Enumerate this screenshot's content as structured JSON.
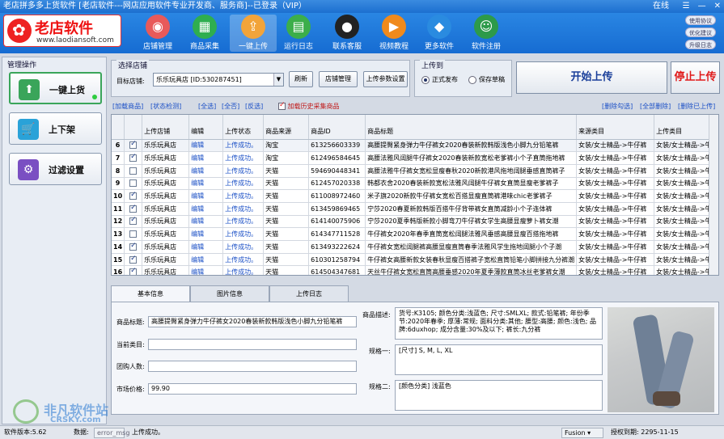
{
  "window": {
    "title": "老店拼多多上货软件 [老店软件---网店应用软件专业开发商、服务商]--已登录（VIP）",
    "online": "在线",
    "controls": [
      "☰",
      "—",
      "✕"
    ]
  },
  "banner": {
    "brand": "老店软件",
    "url": "www.laodiansoft.com",
    "toolbar": [
      {
        "label": "店铺管理",
        "icon": "store-icon",
        "color": "#e85a5a"
      },
      {
        "label": "商品采集",
        "icon": "basket-icon",
        "color": "#2fae4f"
      },
      {
        "label": "一键上传",
        "icon": "upload-icon",
        "color": "#f2a43a"
      },
      {
        "label": "运行日志",
        "icon": "calendar-icon",
        "color": "#3cae4a"
      },
      {
        "label": "联系客服",
        "icon": "qq-penguin-icon",
        "color": "#222222"
      },
      {
        "label": "视频教程",
        "icon": "play-icon",
        "color": "#f08a1c"
      },
      {
        "label": "更多软件",
        "icon": "dropbox-icon",
        "color": "#2a8be0"
      },
      {
        "label": "软件注册",
        "icon": "user-icon",
        "color": "#2d9a4a"
      }
    ],
    "side_buttons": [
      "使用协议",
      "优化建议",
      "升级日志"
    ]
  },
  "left": {
    "title": "管理操作",
    "buttons": [
      {
        "label": "一键上货",
        "icon": "upload-arrow-icon",
        "color": "#3aa55a"
      },
      {
        "label": "上下架",
        "icon": "cart-icon",
        "color": "#2aa2d8"
      },
      {
        "label": "过滤设置",
        "icon": "gear-icon",
        "color": "#7a4fc2"
      }
    ]
  },
  "store": {
    "group_title": "选择店铺",
    "label": "目标店铺:",
    "selected": "乐乐玩具店 [ID:530287451]",
    "refresh": "刷新",
    "manage": "店铺管理",
    "params": "上传参数设置"
  },
  "upload_to": {
    "group_title": "上传到",
    "options": [
      "正式发布",
      "保存草稿"
    ],
    "selected_index": 0
  },
  "actions": {
    "start": "开始上传",
    "stop": "停止上传"
  },
  "links": {
    "left": [
      "[加载商品]",
      "[状态检测]"
    ],
    "select": [
      "[全选]",
      "[全否]",
      "[反选]"
    ],
    "history_label": "加载历史采集商品",
    "history_checked": true,
    "right": [
      "[删除勾选]",
      "[全部删除]",
      "[删除已上传]"
    ]
  },
  "table": {
    "columns": [
      "",
      "",
      "上传店铺",
      "编辑",
      "上传状态",
      "商品来源",
      "商品ID",
      "商品标题",
      "来源类目",
      "上传类目"
    ],
    "rows": [
      {
        "n": "6",
        "checked": true,
        "store": "乐乐玩具店",
        "edit": "编辑",
        "status": "上传成功。",
        "source": "淘宝",
        "id": "613256603339",
        "title": "高腰提臀紧身弹力牛仔裤女2020春装新款韩版浅色小脚九分铅笔裤",
        "src_cat": "女装/女士精品->牛仔裤",
        "up_cat": "女装/女士精品->牛"
      },
      {
        "n": "7",
        "checked": true,
        "store": "乐乐玩具店",
        "edit": "编辑",
        "status": "上传成功。",
        "source": "淘宝",
        "id": "612496584645",
        "title": "高腰法雅风阔腿牛仔裤女2020春装新款宽松老爹裤小个子直筒拖地裤",
        "src_cat": "女装/女士精品->牛仔裤",
        "up_cat": "女装/女士精品->牛"
      },
      {
        "n": "8",
        "checked": false,
        "store": "乐乐玩具店",
        "edit": "编辑",
        "status": "上传成功。",
        "source": "天猫",
        "id": "594690448341",
        "title": "高腰法雅牛仔裤女宽松显瘦春秋2020新款港风拖地阔腿垂感直筒裤子",
        "src_cat": "女装/女士精品->牛仔裤",
        "up_cat": "女装/女士精品->牛"
      },
      {
        "n": "9",
        "checked": false,
        "store": "乐乐玩具店",
        "edit": "编辑",
        "status": "上传成功。",
        "source": "天猫",
        "id": "612457020338",
        "title": "韩都衣舍2020春装新款宽松法雅风阔腿牛仔裤女直筒显瘦老爹裤子",
        "src_cat": "女装/女士精品->牛仔裤",
        "up_cat": "女装/女士精品->牛"
      },
      {
        "n": "10",
        "checked": true,
        "store": "乐乐玩具店",
        "edit": "编辑",
        "status": "上传成功。",
        "source": "天猫",
        "id": "611008972460",
        "title": "米子旗2020新款牛仔裤女宽松百搭显瘦直筒裤港味chic老爹裤子",
        "src_cat": "女装/女士精品->牛仔裤",
        "up_cat": "女装/女士精品->牛"
      },
      {
        "n": "11",
        "checked": true,
        "store": "乐乐玩具店",
        "edit": "编辑",
        "status": "上传成功。",
        "source": "天猫",
        "id": "613459869465",
        "title": "宁莎2020春夏新款韩版百搭牛仔背带裤女直筒减龄小个子连体裤",
        "src_cat": "女装/女士精品->牛仔裤",
        "up_cat": "女装/女士精品->牛"
      },
      {
        "n": "12",
        "checked": true,
        "store": "乐乐玩具店",
        "edit": "编辑",
        "status": "上传成功。",
        "source": "天猫",
        "id": "614140075906",
        "title": "宁莎2020夏季韩版新款小脚弯刀牛仔裤女学生高腰显瘦萝卜裤女潮",
        "src_cat": "女装/女士精品->牛仔裤",
        "up_cat": "女装/女士精品->牛"
      },
      {
        "n": "13",
        "checked": false,
        "store": "乐乐玩具店",
        "edit": "编辑",
        "status": "上传成功。",
        "source": "天猫",
        "id": "614347711528",
        "title": "牛仔裤女2020年春季直筒宽松阔腿法雅风垂感高腰显瘦百搭拖地裤",
        "src_cat": "女装/女士精品->牛仔裤",
        "up_cat": "女装/女士精品->牛"
      },
      {
        "n": "14",
        "checked": true,
        "store": "乐乐玩具店",
        "edit": "编辑",
        "status": "上传成功。",
        "source": "天猫",
        "id": "613493222624",
        "title": "牛仔裤女宽松阔腿裤高腰显瘦直筒春季法雅风学生拖地阔腿小个子潮",
        "src_cat": "女装/女士精品->牛仔裤",
        "up_cat": "女装/女士精品->牛"
      },
      {
        "n": "15",
        "checked": true,
        "store": "乐乐玩具店",
        "edit": "编辑",
        "status": "上传成功。",
        "source": "天猫",
        "id": "610301258794",
        "title": "牛仔裤女高腰新款女装春秋显瘦百搭裤子宽松直筒铅笔小脚拼接九分裤潮",
        "src_cat": "女装/女士精品->牛仔裤",
        "up_cat": "女装/女士精品->牛"
      },
      {
        "n": "16",
        "checked": true,
        "store": "乐乐玩具店",
        "edit": "编辑",
        "status": "上传成功。",
        "source": "天猫",
        "id": "614504347681",
        "title": "天丝牛仔裤女宽松直筒高腰垂感2020年夏季薄款直筒冰丝老爹裤女潮",
        "src_cat": "女装/女士精品->牛仔裤",
        "up_cat": "女装/女士精品->牛"
      },
      {
        "n": "17",
        "checked": true,
        "store": "乐乐玩具店",
        "edit": "编辑",
        "status": "上传成功。",
        "source": "天猫",
        "id": "613268171879",
        "title": "法雅牛仔裤女直筒宽松韩版阔腿裤2020春装新款破洞高腰九分休闲裤",
        "src_cat": "女装/女士精品->牛仔裤",
        "up_cat": "女装/女士精品->牛"
      },
      {
        "n": "18",
        "checked": false,
        "store": "乐乐玩具店",
        "edit": "编辑",
        "status": "上传成功。",
        "source": "天猫",
        "id": "601125598621",
        "title": "烟灰色牛仔裤女2020新款春夏季九分拖地宽松直筒显瘦老爹裤",
        "src_cat": "女装/女士精品->牛仔裤",
        "up_cat": "女装/女士精品->牛"
      }
    ]
  },
  "detail": {
    "tabs": [
      "基本信息",
      "图片信息",
      "上传日志"
    ],
    "active_tab": 0,
    "title_label": "商品标题:",
    "title_value": "高腰提臀紧身弹力牛仔裤女2020春装新款韩版浅色小脚九分铅笔裤",
    "category_label": "当前类目:",
    "category_value": "",
    "group_label": "团购人数:",
    "group_value": "",
    "price_label": "市场价格:",
    "price_value": "99.90",
    "desc_label": "商品描述:",
    "desc_value": "货号:K3105; 颜色分类:浅蓝色; 尺寸:SMLXL; 款式:铅笔裤; 年份季节:2020年春季; 厚薄:常规; 面料分类:其他; 腰型:高腰; 颜色:浅色; 品牌:6duxhop; 成分含量:30%及以下; 裤长:九分裤",
    "spec1_label": "规格一:",
    "spec1_value": "[尺寸] S, M, L, XL",
    "spec2_label": "规格二:",
    "spec2_value": "[颜色分类] 浅蓝色"
  },
  "status": {
    "version": "软件版本:5.62",
    "cache": "数据:",
    "cache_val": "error_msg",
    "message": "上传成功。",
    "skin": "Fusion",
    "expire": "授权到期: 2295-11-15"
  },
  "watermark": {
    "line1": "非凡软件站",
    "line2": "CRSKY.com"
  }
}
